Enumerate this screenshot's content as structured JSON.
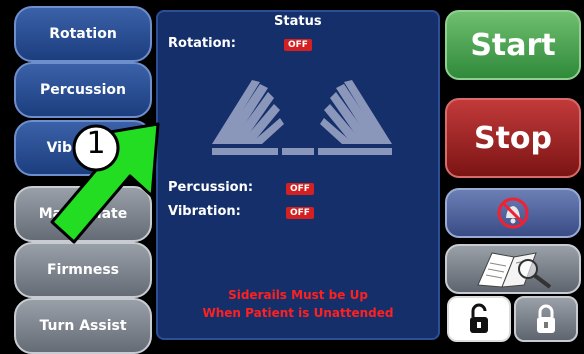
{
  "left_menu": {
    "rotation": "Rotation",
    "percussion": "Percussion",
    "vibration": "Vibration",
    "max_inflate": "Max Inflate",
    "firmness": "Firmness",
    "turn_assist": "Turn Assist"
  },
  "status_panel": {
    "title": "Status",
    "rotation_label": "Rotation:",
    "rotation_state": "OFF",
    "percussion_label": "Percussion:",
    "percussion_state": "OFF",
    "vibration_label": "Vibration:",
    "vibration_state": "OFF",
    "warning_line1": "Siderails Must be Up",
    "warning_line2": "When Patient is Unattended"
  },
  "right_controls": {
    "start": "Start",
    "stop": "Stop",
    "mute_icon": "alarm-mute-icon",
    "manual_icon": "manual-search-icon",
    "unlock_icon": "unlock-icon",
    "lock_icon": "lock-icon"
  },
  "overlay": {
    "step_number": "1",
    "arrow_color": "#22dd22"
  }
}
